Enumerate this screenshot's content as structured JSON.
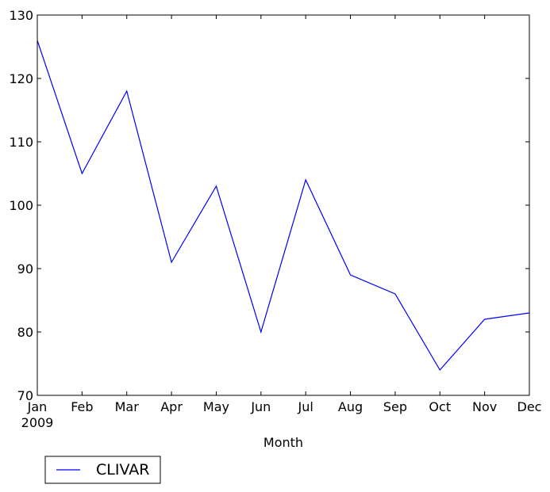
{
  "chart_data": {
    "type": "line",
    "title": "",
    "xlabel": "Month",
    "ylabel": "",
    "categories": [
      "Jan",
      "Feb",
      "Mar",
      "Apr",
      "May",
      "Jun",
      "Jul",
      "Aug",
      "Sep",
      "Oct",
      "Nov",
      "Dec"
    ],
    "x_sublabel": "2009",
    "ylim": [
      70,
      130
    ],
    "yticks": [
      70,
      80,
      90,
      100,
      110,
      120,
      130
    ],
    "grid": false,
    "legend_position": "below-left",
    "series": [
      {
        "name": "CLIVAR",
        "color": "#0000ff",
        "values": [
          126,
          105,
          118,
          91,
          103,
          80,
          104,
          89,
          86,
          74,
          82,
          83
        ]
      }
    ]
  }
}
